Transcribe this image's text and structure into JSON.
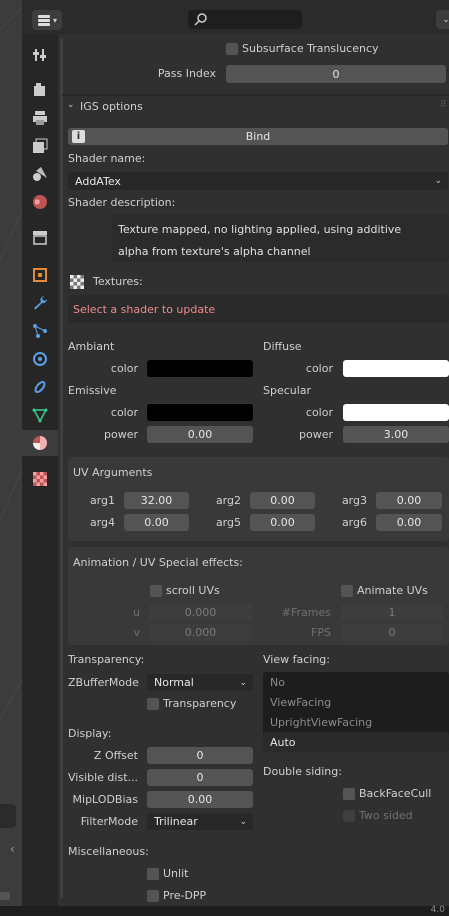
{
  "search": {
    "placeholder": ""
  },
  "subsurface": {
    "label": "Subsurface Translucency"
  },
  "pass_index": {
    "label": "Pass Index",
    "value": "0"
  },
  "igs": {
    "title": "IGS options"
  },
  "bind": {
    "label": "Bind"
  },
  "shader_name": {
    "label": "Shader name:",
    "value": "AddATex"
  },
  "shader_description": {
    "label": "Shader description:",
    "line1": "Texture mapped, no lighting applied, using additive",
    "line2": "alpha from texture's alpha channel"
  },
  "textures": {
    "label": "Textures:",
    "message": "Select a shader to update"
  },
  "ambiant": {
    "title": "Ambiant",
    "color_label": "color",
    "color": "#000000"
  },
  "diffuse": {
    "title": "Diffuse",
    "color_label": "color",
    "color": "#ffffff"
  },
  "emissive": {
    "title": "Emissive",
    "color_label": "color",
    "color": "#000000",
    "power_label": "power",
    "power": "0.00"
  },
  "specular": {
    "title": "Specular",
    "color_label": "color",
    "color": "#ffffff",
    "power_label": "power",
    "power": "3.00"
  },
  "uv_args": {
    "title": "UV Arguments",
    "args": [
      {
        "label": "arg1",
        "value": "32.00"
      },
      {
        "label": "arg2",
        "value": "0.00"
      },
      {
        "label": "arg3",
        "value": "0.00"
      },
      {
        "label": "arg4",
        "value": "0.00"
      },
      {
        "label": "arg5",
        "value": "0.00"
      },
      {
        "label": "arg6",
        "value": "0.00"
      }
    ]
  },
  "anim": {
    "title": "Animation / UV Special effects:",
    "scroll_label": "scroll UVs",
    "animate_label": "Animate UVs",
    "u_label": "u",
    "u_value": "0.000",
    "v_label": "v",
    "v_value": "0.000",
    "frames_label": "#Frames",
    "frames_value": "1",
    "fps_label": "FPS",
    "fps_value": "0"
  },
  "transparency": {
    "label": "Transparency:",
    "zbuffer_label": "ZBufferMode",
    "zbuffer_value": "Normal",
    "transparency_checkbox": "Transparency"
  },
  "view_facing": {
    "label": "View facing:",
    "options": [
      "No",
      "ViewFacing",
      "UprightViewFacing"
    ],
    "selected": "Auto"
  },
  "display": {
    "label": "Display:",
    "z_offset_label": "Z Offset",
    "z_offset": "0",
    "visible_dist_label": "Visible dist...",
    "visible_dist": "0",
    "mip_label": "MipLODBias",
    "mip": "0.00",
    "filter_label": "FilterMode",
    "filter": "Trilinear"
  },
  "double_siding": {
    "label": "Double siding:",
    "backface": "BackFaceCull",
    "two_sided": "Two sided"
  },
  "misc": {
    "label": "Miscellaneous:",
    "unlit": "Unlit",
    "predpp": "Pre-DPP"
  },
  "status": {
    "version": "4.0"
  }
}
